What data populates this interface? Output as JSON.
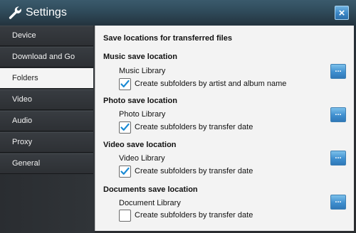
{
  "window": {
    "title": "Settings",
    "close_label": "×"
  },
  "sidebar": {
    "items": [
      {
        "label": "Device",
        "active": false
      },
      {
        "label": "Download and Go",
        "active": false
      },
      {
        "label": "Folders",
        "active": true
      },
      {
        "label": "Video",
        "active": false
      },
      {
        "label": "Audio",
        "active": false
      },
      {
        "label": "Proxy",
        "active": false
      },
      {
        "label": "General",
        "active": false
      }
    ]
  },
  "content": {
    "heading": "Save locations for transferred files",
    "browse_label": "...",
    "sections": [
      {
        "title": "Music save location",
        "location": "Music Library",
        "option_label": "Create subfolders by artist and album name",
        "checked": true
      },
      {
        "title": "Photo save location",
        "location": "Photo Library",
        "option_label": "Create subfolders by transfer date",
        "checked": true
      },
      {
        "title": "Video save location",
        "location": "Video Library",
        "option_label": "Create subfolders by transfer date",
        "checked": true
      },
      {
        "title": "Documents save location",
        "location": "Document Library",
        "option_label": "Create subfolders by transfer date",
        "checked": false
      }
    ]
  },
  "colors": {
    "accent": "#3f8fcf",
    "check": "#1a8ad4",
    "sidebar_active_bg": "#f4f4f4",
    "content_bg": "#f3f3f3"
  },
  "icons": {
    "title": "wrench-icon",
    "close": "close-icon",
    "check": "checkmark-icon"
  }
}
